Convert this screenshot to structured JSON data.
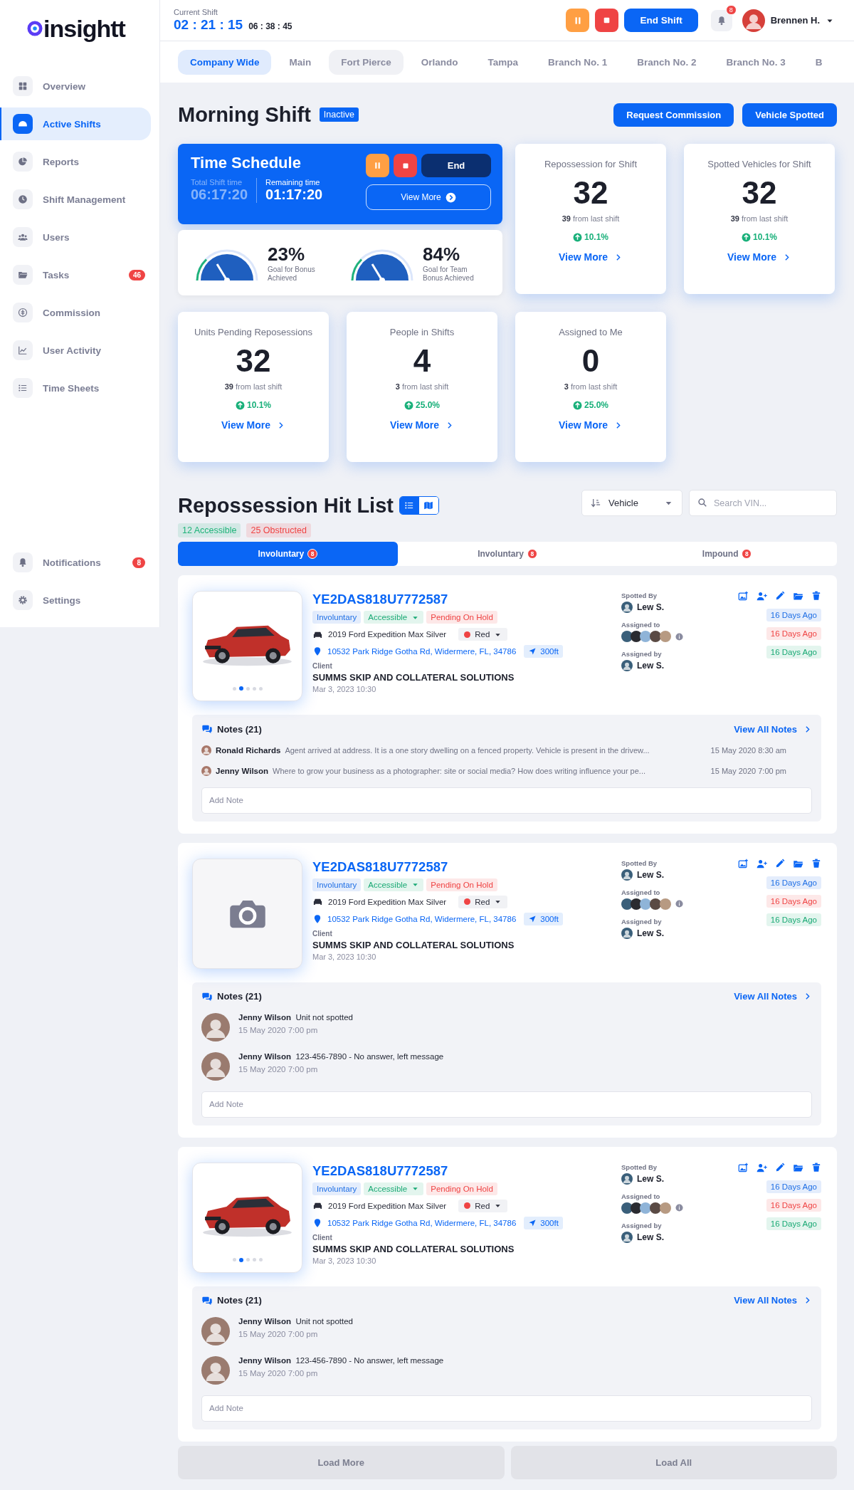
{
  "brand": {
    "name": "insightt"
  },
  "sidebar": {
    "items": [
      {
        "label": "Overview",
        "selected": false
      },
      {
        "label": "Active Shifts",
        "selected": true
      },
      {
        "label": "Reports",
        "selected": false
      },
      {
        "label": "Shift Management",
        "selected": false
      },
      {
        "label": "Users",
        "selected": false
      },
      {
        "label": "Tasks",
        "selected": false,
        "badge": "46"
      },
      {
        "label": "Commission",
        "selected": false
      },
      {
        "label": "User Activity",
        "selected": false
      },
      {
        "label": "Time Sheets",
        "selected": false
      }
    ],
    "footer_items": [
      {
        "label": "Notifications",
        "selected": false,
        "badge": "8"
      },
      {
        "label": "Settings",
        "selected": false
      }
    ]
  },
  "header": {
    "shift_label": "Current Shift",
    "elapsed": "02 : 21 : 15",
    "remaining": "06 : 38 : 45",
    "end_button": "End Shift",
    "notification_count": "8",
    "user_name": "Brennen H."
  },
  "branch_tabs": [
    {
      "label": "Company Wide",
      "selected": true,
      "highlighted": false
    },
    {
      "label": "Main",
      "selected": false,
      "highlighted": false
    },
    {
      "label": "Fort Pierce",
      "selected": false,
      "highlighted": true
    },
    {
      "label": "Orlando",
      "selected": false,
      "highlighted": false
    },
    {
      "label": "Tampa",
      "selected": false,
      "highlighted": false
    },
    {
      "label": "Branch No. 1",
      "selected": false,
      "highlighted": false
    },
    {
      "label": "Branch No. 2",
      "selected": false,
      "highlighted": false
    },
    {
      "label": "Branch No. 3",
      "selected": false,
      "highlighted": false
    },
    {
      "label": "B",
      "selected": false,
      "highlighted": false
    }
  ],
  "shift": {
    "title": "Morning Shift",
    "status": "Inactive",
    "actions": [
      "Request Commission",
      "Vehicle Spotted"
    ]
  },
  "time_schedule": {
    "title": "Time Schedule",
    "total_label": "Total Shift time",
    "total": "06:17:20",
    "remaining_label": "Remaining time",
    "remaining": "01:17:20",
    "end_button": "End",
    "view_more": "View More"
  },
  "gauges": [
    {
      "value": "23%",
      "caption": "Goal for Bonus Achieved"
    },
    {
      "value": "84%",
      "caption": "Goal for Team Bonus Achieved"
    }
  ],
  "stats": [
    {
      "title": "Repossession for Shift",
      "value": "32",
      "comparison": "**39** from last shift",
      "change": "10.1%",
      "link": "View More"
    },
    {
      "title": "Spotted Vehicles for Shift",
      "value": "32",
      "comparison": "**39** from last shift",
      "change": "10.1%",
      "link": "View More"
    },
    {
      "title": "Units Pending Reposessions",
      "value": "32",
      "comparison": "**39** from last shift",
      "change": "10.1%",
      "link": "View More"
    },
    {
      "title": "People in Shifts",
      "value": "4",
      "comparison": "**3** from last shift",
      "change": "25.0%",
      "link": "View More"
    },
    {
      "title": "Assigned to Me",
      "value": "0",
      "comparison": "**3** from last shift",
      "change": "25.0%",
      "link": "View More"
    }
  ],
  "hit_list": {
    "title": "Repossession Hit List",
    "views": [
      {
        "selected": true
      },
      {
        "selected": false
      }
    ],
    "counts": [
      {
        "label": "12 Accessible",
        "color": "#1fb37a"
      },
      {
        "label": "25 Obstructed",
        "color": "#ef4444"
      }
    ],
    "sort": {
      "value": "Vehicle"
    },
    "search": {
      "placeholder": "Search VIN..."
    },
    "tabs": [
      {
        "label": "Involuntary",
        "count": "8",
        "selected": true
      },
      {
        "label": "Involuntary",
        "count": "8",
        "selected": false
      },
      {
        "label": "Impound",
        "count": "8",
        "selected": false
      }
    ],
    "cards": [
      {
        "vin": "YE2DAS818U7772587",
        "image": {
          "kind": "picture",
          "slides": [
            false,
            true,
            false,
            false,
            false
          ]
        },
        "tags": [
          {
            "label": "Involuntary",
            "color": "#1f6fe5",
            "dropdown": false
          },
          {
            "label": "Accessible",
            "color": "#19a974",
            "dropdown": true
          },
          {
            "label": "Pending On Hold",
            "color": "#ef4444",
            "dropdown": false
          }
        ],
        "vehicle": "2019 Ford Expedition Max Silver",
        "vehicle_color": {
          "label": "Red",
          "color": "#ef4444"
        },
        "address": "10532 Park Ridge Gotha Rd, Widermere, FL, 34786",
        "distance": "300ft",
        "client_label": "Client",
        "client": "SUMMS SKIP AND COLLATERAL SOLUTIONS",
        "date": "Mar 3, 2023 10:30",
        "spotted_by_label": "Spotted By",
        "spotted_by": "Lew S.",
        "assigned_to_label": "Assigned to",
        "assigned_by_label": "Assigned by",
        "assigned_by": "Lew S.",
        "ages": [
          {
            "label": "16 Days Ago",
            "color": "#1f6fe5"
          },
          {
            "label": "16 Days Ago",
            "color": "#ef4444"
          },
          {
            "label": "16 Days Ago",
            "color": "#19a974"
          }
        ],
        "notes": {
          "title": "Notes (21)",
          "link": "View All Notes",
          "input": {
            "placeholder": "Add Note"
          },
          "items": [
            {
              "kind": "inline",
              "author": "Ronald Richards",
              "text": "Agent arrived at address. It is a one story dwelling on a fenced property. Vehicle is present in the drivew...",
              "time": "15 May 2020 8:30 am"
            },
            {
              "kind": "inline",
              "author": "Jenny Wilson",
              "text": "Where to grow your business as a photographer: site or social media? How does writing influence your pe...",
              "time": "15 May 2020 7:00 pm"
            }
          ]
        }
      },
      {
        "vin": "YE2DAS818U7772587",
        "image": {
          "kind": "placeholder"
        },
        "tags": [
          {
            "label": "Involuntary",
            "color": "#1f6fe5",
            "dropdown": false
          },
          {
            "label": "Accessible",
            "color": "#19a974",
            "dropdown": true
          },
          {
            "label": "Pending On Hold",
            "color": "#ef4444",
            "dropdown": false
          }
        ],
        "vehicle": "2019 Ford Expedition Max Silver",
        "vehicle_color": {
          "label": "Red",
          "color": "#ef4444"
        },
        "address": "10532 Park Ridge Gotha Rd, Widermere, FL, 34786",
        "distance": "300ft",
        "client_label": "Client",
        "client": "SUMMS SKIP AND COLLATERAL SOLUTIONS",
        "date": "Mar 3, 2023 10:30",
        "spotted_by_label": "Spotted By",
        "spotted_by": "Lew S.",
        "assigned_to_label": "Assigned to",
        "assigned_by_label": "Assigned by",
        "assigned_by": "Lew S.",
        "ages": [
          {
            "label": "16 Days Ago",
            "color": "#1f6fe5"
          },
          {
            "label": "16 Days Ago",
            "color": "#ef4444"
          },
          {
            "label": "16 Days Ago",
            "color": "#19a974"
          }
        ],
        "notes": {
          "title": "Notes (21)",
          "link": "View All Notes",
          "input": {
            "placeholder": "Add Note"
          },
          "items": [
            {
              "kind": "stacked",
              "author": "Jenny Wilson",
              "text": "Unit not spotted",
              "time": "15 May 2020 7:00 pm"
            },
            {
              "kind": "stacked",
              "author": "Jenny Wilson",
              "text": "123-456-7890 - No answer, left message",
              "time": "15 May 2020 7:00 pm"
            }
          ]
        }
      },
      {
        "vin": "YE2DAS818U7772587",
        "image": {
          "kind": "picture",
          "slides": [
            false,
            true,
            false,
            false,
            false
          ]
        },
        "tags": [
          {
            "label": "Involuntary",
            "color": "#1f6fe5",
            "dropdown": false
          },
          {
            "label": "Accessible",
            "color": "#19a974",
            "dropdown": true
          },
          {
            "label": "Pending On Hold",
            "color": "#ef4444",
            "dropdown": false
          }
        ],
        "vehicle": "2019 Ford Expedition Max Silver",
        "vehicle_color": {
          "label": "Red",
          "color": "#ef4444"
        },
        "address": "10532 Park Ridge Gotha Rd, Widermere, FL, 34786",
        "distance": "300ft",
        "client_label": "Client",
        "client": "SUMMS SKIP AND COLLATERAL SOLUTIONS",
        "date": "Mar 3, 2023 10:30",
        "spotted_by_label": "Spotted By",
        "spotted_by": "Lew S.",
        "assigned_to_label": "Assigned to",
        "assigned_by_label": "Assigned by",
        "assigned_by": "Lew S.",
        "ages": [
          {
            "label": "16 Days Ago",
            "color": "#1f6fe5"
          },
          {
            "label": "16 Days Ago",
            "color": "#ef4444"
          },
          {
            "label": "16 Days Ago",
            "color": "#19a974"
          }
        ],
        "notes": {
          "title": "Notes (21)",
          "link": "View All Notes",
          "input": {
            "placeholder": "Add Note"
          },
          "items": [
            {
              "kind": "stacked",
              "author": "Jenny Wilson",
              "text": "Unit not spotted",
              "time": "15 May 2020 7:00 pm"
            },
            {
              "kind": "stacked",
              "author": "Jenny Wilson",
              "text": "123-456-7890 - No answer, left message",
              "time": "15 May 2020 7:00 pm"
            }
          ]
        }
      }
    ],
    "load_more": "Load More",
    "load_all": "Load All"
  }
}
